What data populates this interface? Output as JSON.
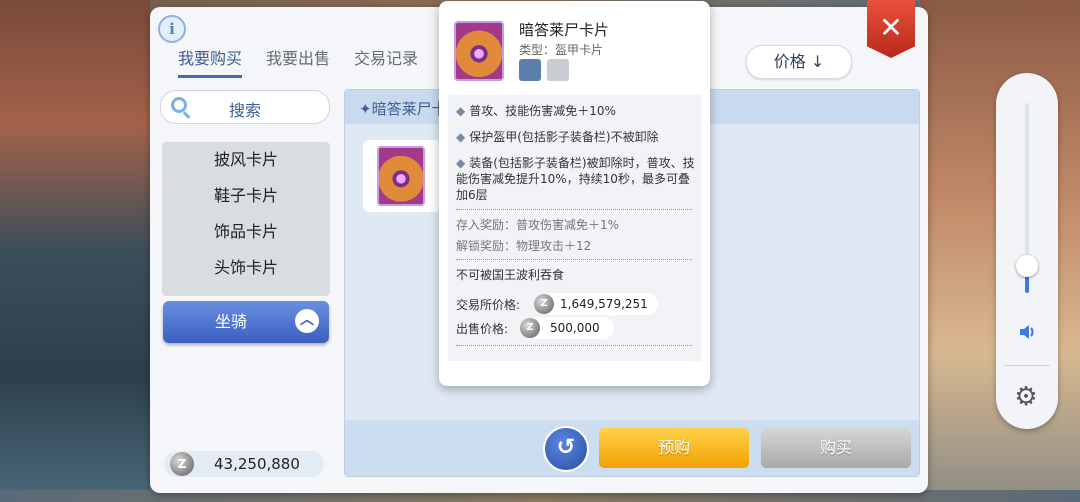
{
  "tabs": [
    {
      "label": "我要购买",
      "active": true
    },
    {
      "label": "我要出售",
      "active": false
    },
    {
      "label": "交易记录",
      "active": false
    }
  ],
  "sort": {
    "label": "价格 ↓"
  },
  "search": {
    "label": "搜索"
  },
  "categories": [
    {
      "label": "披风卡片"
    },
    {
      "label": "鞋子卡片"
    },
    {
      "label": "饰品卡片"
    },
    {
      "label": "头饰卡片"
    }
  ],
  "mount_button": {
    "label": "坐骑"
  },
  "balance": {
    "value": "43,250,880",
    "coin_symbol": "Z"
  },
  "list": {
    "header_title": "✦暗答莱尸卡"
  },
  "actions": {
    "preorder_label": "预购",
    "buy_label": "购买",
    "back_symbol": "↺"
  },
  "close": {
    "symbol": "✕"
  },
  "popup": {
    "title": "暗答莱尸卡片",
    "type": "类型：盔甲卡片",
    "effects": [
      "普攻、技能伤害减免＋10%",
      "保护盔甲(包括影子装备栏)不被卸除",
      "装备(包括影子装备栏)被卸除时，普攻、技能伤害减免提升10%，持续10秒，最多可叠加6层"
    ],
    "deposit_reward": "存入奖励：普攻伤害减免＋1%",
    "unlock_reward": "解锁奖励：物理攻击＋12",
    "note": "不可被国王波利吞食",
    "exchange_price_label": "交易所价格:",
    "exchange_price": "1,649,579,251",
    "sell_price_label": "出售价格:",
    "sell_price": "500,000"
  },
  "side_widget": {
    "volume_level": 0.15
  },
  "colors": {
    "accent": "#3d6fb6",
    "preorder": "#f2a100",
    "close": "#d93a2a"
  }
}
